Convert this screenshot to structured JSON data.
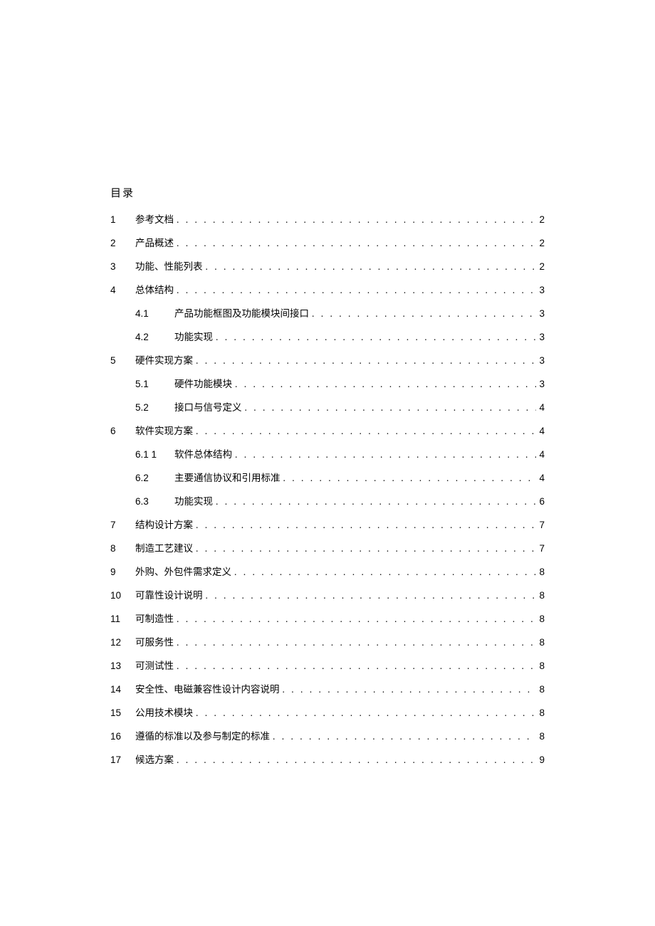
{
  "title": "目录",
  "entries": [
    {
      "num": "1",
      "label": "参考文档",
      "page": "2",
      "level": 1
    },
    {
      "num": "2",
      "label": "产品概述",
      "page": "2",
      "level": 1
    },
    {
      "num": "3",
      "label": "功能、性能列表",
      "page": "2",
      "level": 1
    },
    {
      "num": "4",
      "label": "总体结构",
      "page": "3",
      "level": 1
    },
    {
      "num": "4.1",
      "label": "产品功能框图及功能模块间接口",
      "page": "3",
      "level": 2
    },
    {
      "num": "4.2",
      "label": "功能实现",
      "page": "3",
      "level": 2
    },
    {
      "num": "5",
      "label": "硬件实现方案",
      "page": "3",
      "level": 1
    },
    {
      "num": "5.1",
      "label": "硬件功能模块",
      "page": "3",
      "level": 2
    },
    {
      "num": "5.2",
      "label": "接口与信号定义",
      "page": "4",
      "level": 2
    },
    {
      "num": "6",
      "label": "软件实现方案",
      "page": "4",
      "level": 1
    },
    {
      "num": "6.1 1",
      "label": "软件总体结构",
      "page": "4",
      "level": 2
    },
    {
      "num": "6.2",
      "label": "主要通信协议和引用标准",
      "page": "4",
      "level": 2
    },
    {
      "num": "6.3",
      "label": "功能实现",
      "page": "6",
      "level": 2
    },
    {
      "num": "7",
      "label": "结构设计方案",
      "page": "7",
      "level": 1
    },
    {
      "num": "8",
      "label": "制造工艺建议",
      "page": "7",
      "level": 1
    },
    {
      "num": "9",
      "label": "外购、外包件需求定义",
      "page": "8",
      "level": 1
    },
    {
      "num": "10",
      "label": "可靠性设计说明",
      "page": "8",
      "level": 1
    },
    {
      "num": "11",
      "label": "可制造性",
      "page": "8",
      "level": 1
    },
    {
      "num": "12",
      "label": "可服务性",
      "page": "8",
      "level": 1
    },
    {
      "num": "13",
      "label": "可测试性",
      "page": "8",
      "level": 1
    },
    {
      "num": "14",
      "label": "安全性、电磁兼容性设计内容说明",
      "page": "8",
      "level": 1
    },
    {
      "num": "15",
      "label": "公用技术模块",
      "page": "8",
      "level": 1
    },
    {
      "num": "16",
      "label": "遵循的标准以及参与制定的标准",
      "page": "8",
      "level": 1
    },
    {
      "num": "17",
      "label": "候选方案",
      "page": "9",
      "level": 1
    }
  ],
  "dots": ". . . . . . . . . . . . . . . . . . . . . . . . . . . . . . . . . . . . . . . . . . . . . . . . . . . . . . . . . . . . . . . . . . . . . . . . . . . . . . . . . . . . . . . . . . . . . . . . . . . ."
}
